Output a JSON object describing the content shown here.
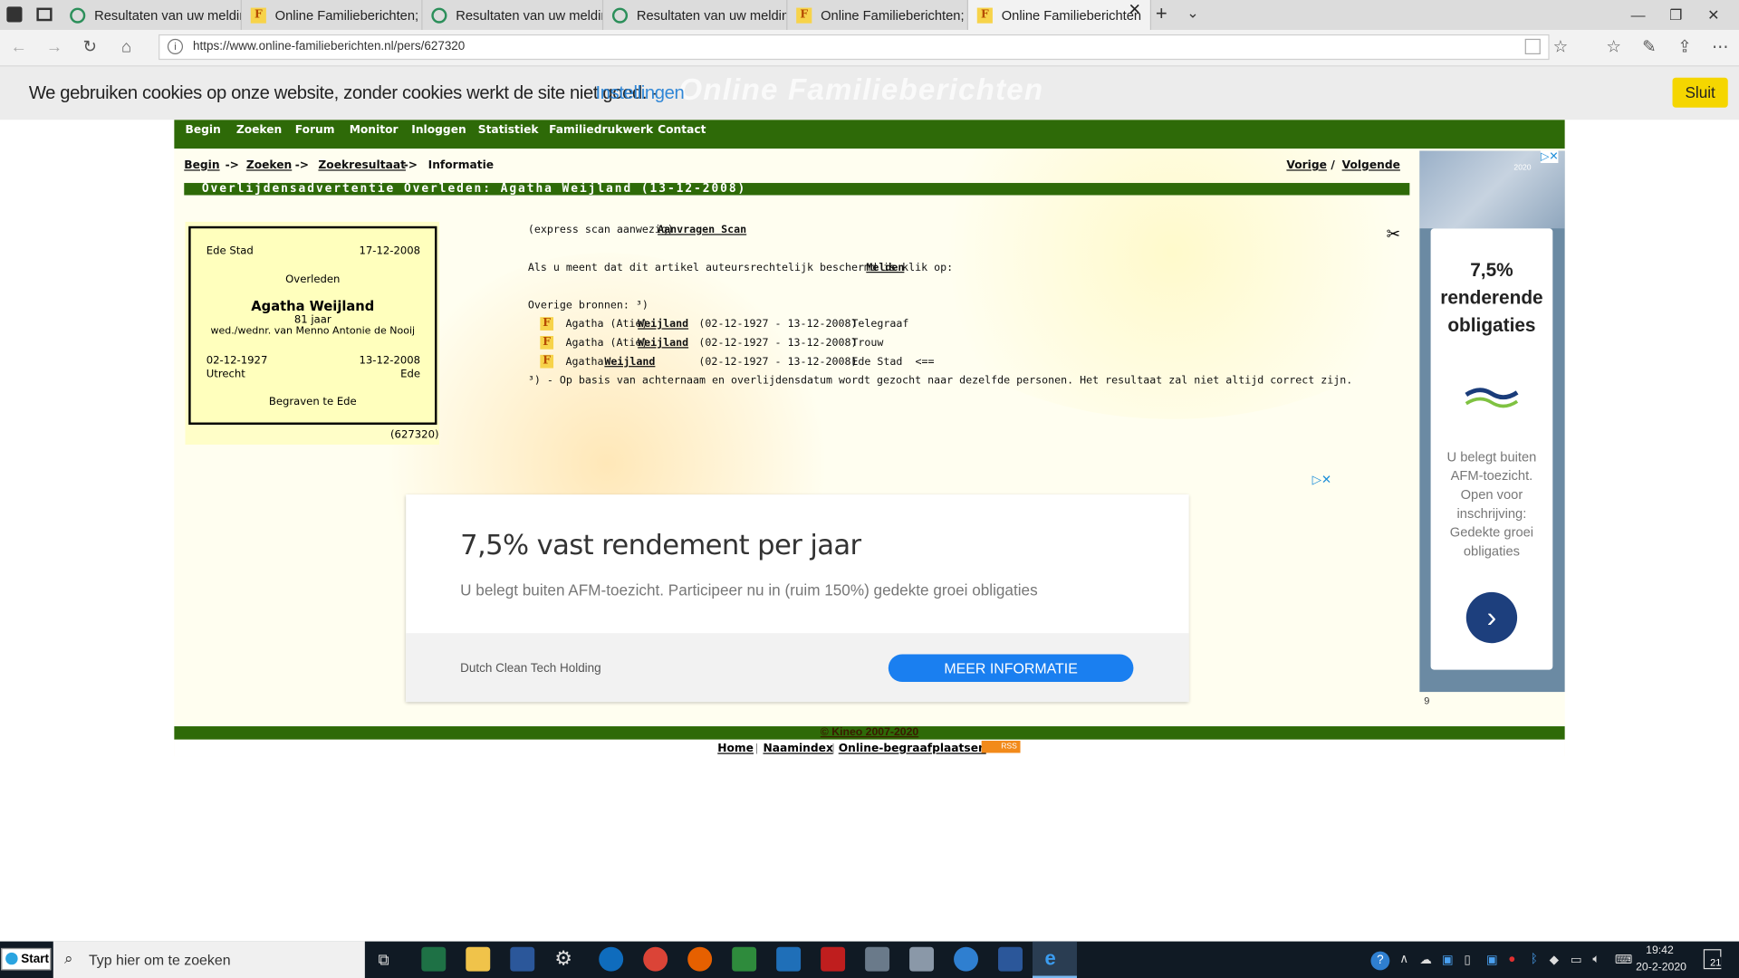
{
  "browser": {
    "tabs": [
      {
        "title": "Resultaten van uw meldinge",
        "icon": "green-circle-icon"
      },
      {
        "title": "Online Familieberichten; Ov",
        "icon": "familieberichten-icon"
      },
      {
        "title": "Resultaten van uw meldinge",
        "icon": "green-circle-icon"
      },
      {
        "title": "Resultaten van uw meldinge",
        "icon": "green-circle-icon"
      },
      {
        "title": "Online Familieberichten; Ov",
        "icon": "familieberichten-icon"
      },
      {
        "title": "Online Familieberichten",
        "icon": "familieberichten-icon",
        "active": true
      }
    ],
    "url": "https://www.online-familieberichten.nl/pers/627320"
  },
  "cookie": {
    "text": "We gebruiken cookies op onze website, zonder cookies werkt de site niet goed. -",
    "link": "Instellingen",
    "close": "Sluit",
    "watermark": "Online Familieberichten"
  },
  "nav": [
    "Begin",
    "Zoeken",
    "Forum",
    "Monitor",
    "Inloggen",
    "Statistiek",
    "Familiedrukwerk",
    "Contact"
  ],
  "breadcrumb": {
    "begin": "Begin",
    "zoeken": "Zoeken",
    "zoekresultaat": "Zoekresultaat",
    "current": "Informatie",
    "sep": "->"
  },
  "pager": {
    "prev": "Vorige",
    "slash": "/",
    "next": "Volgende"
  },
  "title": "Overlijdensadvertentie Overleden: Agatha Weijland (13-12-2008)",
  "card": {
    "place": "Ede Stad",
    "date": "17-12-2008",
    "heading": "Overleden",
    "name": "Agatha Weijland",
    "age": "81 jaar",
    "spouse": "wed./wednr. van Menno Antonie de Nooij",
    "birth_date": "02-12-1927",
    "death_date": "13-12-2008",
    "birth_place": "Utrecht",
    "death_place": "Ede",
    "burial": "Begraven te Ede",
    "id": "(627320)"
  },
  "info": {
    "scan_prefix": "(express scan aanwezig)",
    "scan_link": "Aanvragen Scan",
    "copyright_text": "Als u meent dat dit artikel auteursrechtelijk beschermd is klik op:",
    "copyright_link": "Melden",
    "sources_label": "Overige bronnen: ³)",
    "sources": [
      {
        "first": "Agatha (Atie)",
        "surname": "Weijland",
        "dates": "(02-12-1927 - 13-12-2008)",
        "paper": "Telegraaf"
      },
      {
        "first": "Agatha (Atie)",
        "surname": "Weijland",
        "dates": "(02-12-1927 - 13-12-2008)",
        "paper": "Trouw"
      },
      {
        "first": "Agatha",
        "surname": "Weijland",
        "dates": "(02-12-1927 - 13-12-2008)",
        "paper": "Ede Stad  <=="
      }
    ],
    "footnote": "³) - Op basis van achternaam en overlijdensdatum wordt gezocht naar dezelfde personen. Het resultaat zal niet altijd correct zijn."
  },
  "ad": {
    "headline": "7,5% vast rendement per jaar",
    "body": "U belegt buiten AFM-toezicht. Participeer nu in (ruim 150%) gedekte groei obligaties",
    "advertiser": "Dutch Clean Tech Holding",
    "cta": "MEER INFORMATIE"
  },
  "side_ad": {
    "headline": "7,5% renderende obligaties",
    "body": "U belegt buiten AFM-toezicht. Open voor inschrijving: Gedekte groei obligaties",
    "image_label": "2020",
    "count": "9"
  },
  "footer": {
    "copyright": "© Kineo 2007-2020",
    "links": [
      "Home",
      "Naamindex",
      "Online-begraafplaatsen"
    ],
    "rss": "RSS"
  },
  "taskbar": {
    "start": "Start",
    "search_placeholder": "Typ hier om te zoeken",
    "time": "19:42",
    "date": "20-2-2020",
    "notification_count": "21"
  }
}
